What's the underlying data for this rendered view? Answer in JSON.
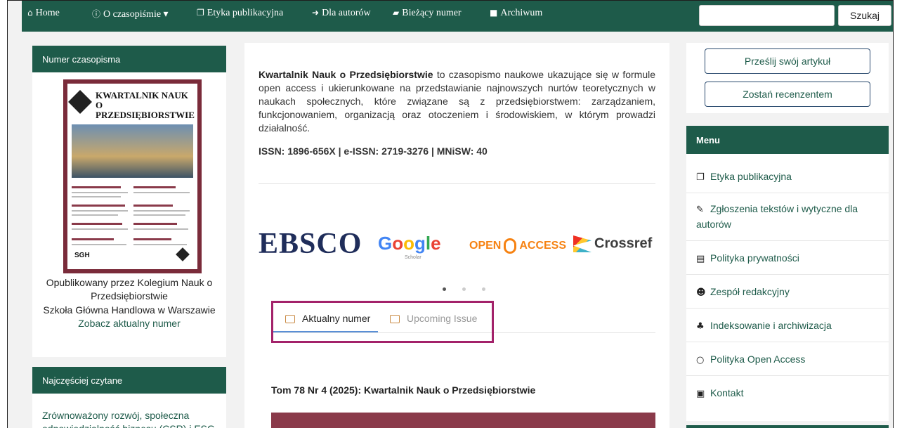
{
  "nav": {
    "items": [
      {
        "icon": "home-icon",
        "glyph": "⌂",
        "label": "Home"
      },
      {
        "icon": "info-icon",
        "glyph": "ⓘ",
        "label": "O czasopiśmie ▾"
      },
      {
        "icon": "copy-icon",
        "glyph": "❐",
        "label": "Etyka publikacyjna"
      },
      {
        "icon": "sign-in-icon",
        "glyph": "➜",
        "label": "Dla autorów"
      },
      {
        "icon": "book-icon",
        "glyph": "▰",
        "label": "Bieżący numer"
      },
      {
        "icon": "archive-icon",
        "glyph": "■",
        "label": "Archiwum"
      }
    ],
    "search_placeholder": "",
    "search_button": "Szukaj"
  },
  "left": {
    "issue_panel_title": "Numer czasopisma",
    "cover_title": "KWARTALNIK NAUK O PRZEDSIĘBIORSTWIE",
    "cover_publisher": "SGH",
    "published_by": "Opublikowany przez Kolegium Nauk o Przedsiębiorstwie",
    "school": "Szkoła Główna Handlowa w Warszawie",
    "current_issue_link": "Zobacz aktualny numer",
    "most_read_title": "Najczęściej czytane",
    "most_read_item": "Zrównoważony rozwój, społeczna odpowiedzialność biznesu (CSR) i ESG w"
  },
  "center": {
    "intro_bold": "Kwartalnik Nauk o Przedsiębiorstwie",
    "intro_rest": " to czasopismo naukowe ukazujące się w formule open access i ukierunkowane na przedstawianie najnowszych nurtów teoretycznych w naukach społecznych, które związane są z przedsiębiorstwem: zarządzaniem, funkcjonowaniem, organizacją oraz otoczeniem i środowiskiem, w którym prowadzi działalność.",
    "issn": "ISSN: 1896-656X | e-ISSN: 2719-3276 | MNiSW: 40",
    "logos": {
      "ebsco": "EBSCO",
      "google": [
        "G",
        "o",
        "o",
        "g",
        "l",
        "e"
      ],
      "scholar": "Scholar",
      "open_left": "OPEN",
      "open_right": "ACCESS",
      "crossref": "Crossref"
    },
    "tabs": [
      {
        "label": "Aktualny numer",
        "active": true
      },
      {
        "label": "Upcoming Issue",
        "active": false
      }
    ],
    "issue_heading": "Tom 78 Nr 4 (2025): Kwartalnik Nauk o Przedsiębiorstwie"
  },
  "right": {
    "submit_button": "Prześlij swój artykuł",
    "reviewer_button": "Zostań recenzentem",
    "menu_title": "Menu",
    "menu_items": [
      {
        "icon": "copy-icon",
        "glyph": "❐",
        "label": "Etyka publikacyjna"
      },
      {
        "icon": "edit-icon",
        "glyph": "✎",
        "label": "Zgłoszenia tekstów i wytyczne dla autorów"
      },
      {
        "icon": "file-icon",
        "glyph": "▤",
        "label": "Polityka prywatności"
      },
      {
        "icon": "users-icon",
        "glyph": "☻",
        "label": "Zespół redakcyjny"
      },
      {
        "icon": "sitemap-icon",
        "glyph": "♣",
        "label": "Indeksowanie i archiwizacja"
      },
      {
        "icon": "circle-icon",
        "glyph": "○",
        "label": "Polityka Open Access"
      },
      {
        "icon": "contact-icon",
        "glyph": "▣",
        "label": "Kontakt"
      }
    ]
  },
  "colors": {
    "brand_green": "#1e5b4a",
    "cover_maroon": "#7a2b3a",
    "highlight_magenta": "#a3226a",
    "tab_underline": "#5a8fd6"
  }
}
